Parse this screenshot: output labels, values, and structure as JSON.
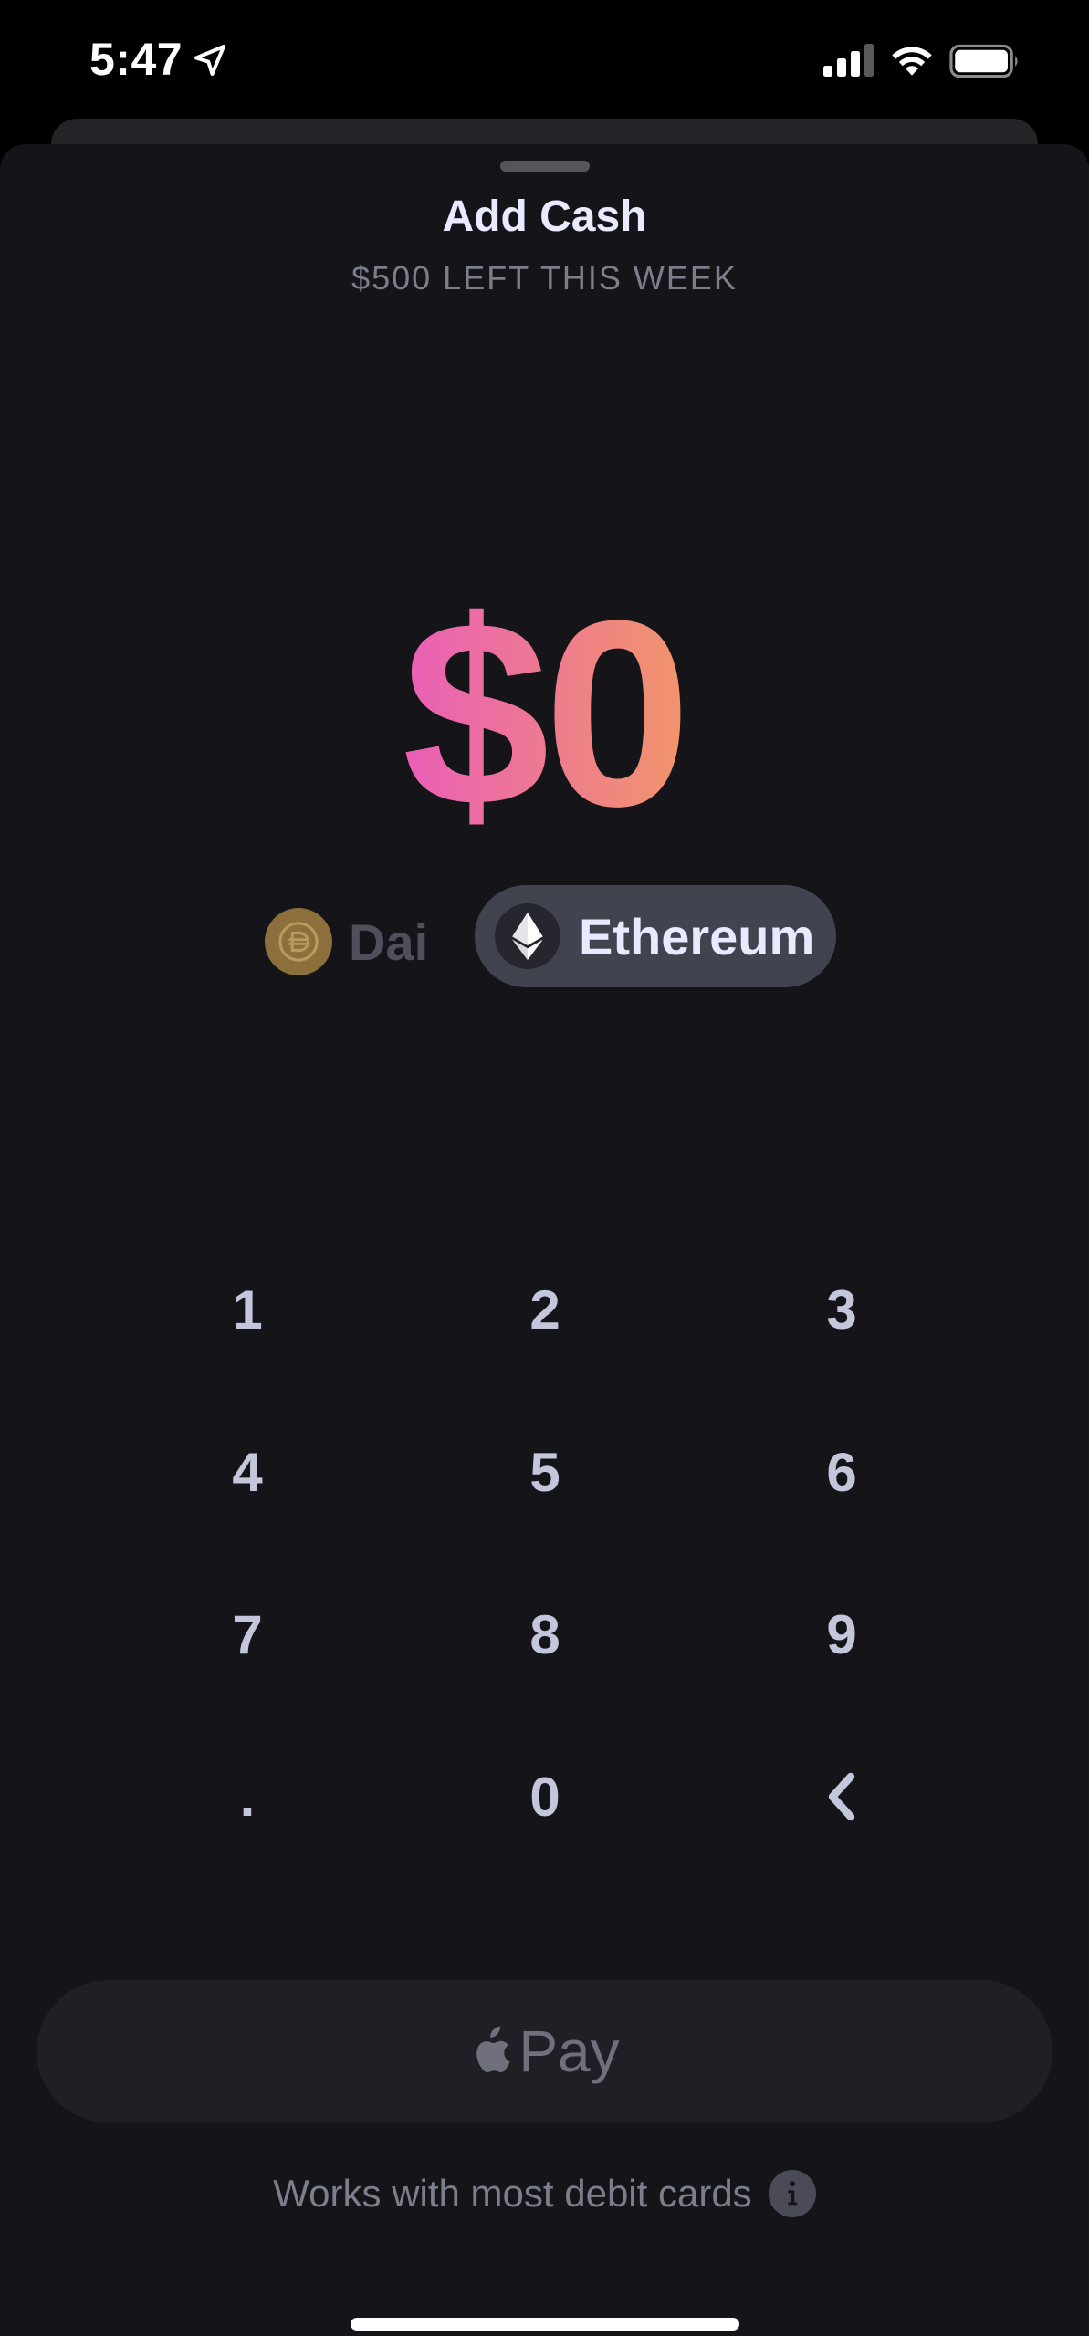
{
  "status_bar": {
    "time": "5:47"
  },
  "header": {
    "title": "Add Cash",
    "subtitle": "$500 LEFT THIS WEEK"
  },
  "amount": {
    "text": "$0",
    "gradient_start": "#e95bbd",
    "gradient_end": "#f29a63"
  },
  "currencies": [
    {
      "label": "Dai",
      "selected": false,
      "icon": "dai-icon"
    },
    {
      "label": "Ethereum",
      "selected": true,
      "icon": "ethereum-icon"
    }
  ],
  "keypad": {
    "keys": [
      "1",
      "2",
      "3",
      "4",
      "5",
      "6",
      "7",
      "8",
      "9",
      ".",
      "0"
    ],
    "backspace_icon": "chevron-left-icon"
  },
  "apple_pay": {
    "label": "Pay",
    "icon": "apple-icon"
  },
  "footer": {
    "text": "Works with most debit cards",
    "info_icon": "info-icon"
  }
}
